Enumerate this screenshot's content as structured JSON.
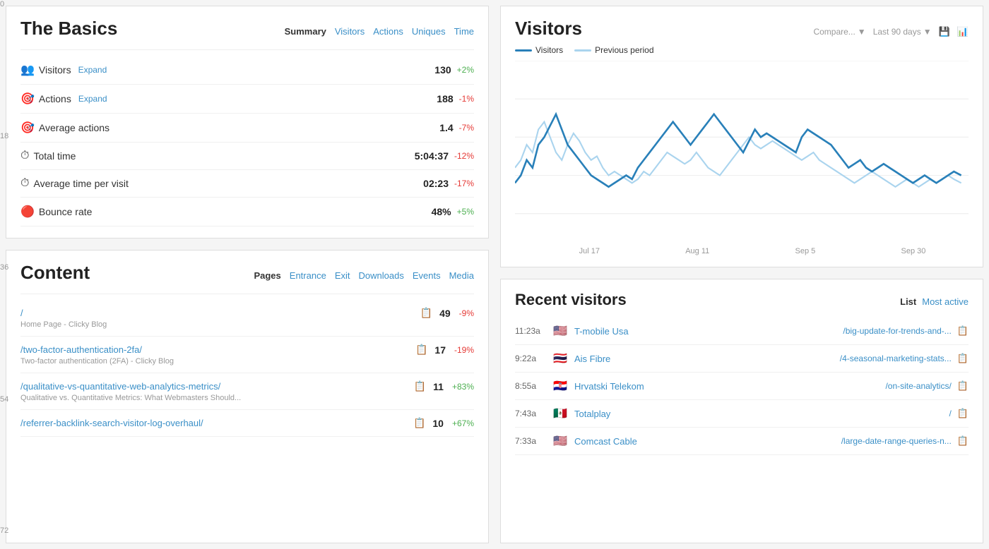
{
  "basics": {
    "title": "The Basics",
    "nav": {
      "summary": "Summary",
      "visitors": "Visitors",
      "actions": "Actions",
      "uniques": "Uniques",
      "time": "Time"
    },
    "stats": [
      {
        "icon": "👥",
        "label": "Visitors",
        "expand": true,
        "value": "130",
        "change": "+2%",
        "pos": true
      },
      {
        "icon": "🎯",
        "label": "Actions",
        "expand": true,
        "value": "188",
        "change": "-1%",
        "pos": false
      },
      {
        "icon": "🎯",
        "label": "Average actions",
        "expand": false,
        "value": "1.4",
        "change": "-7%",
        "pos": false
      },
      {
        "icon": "⏱",
        "label": "Total time",
        "expand": false,
        "value": "5:04:37",
        "change": "-12%",
        "pos": false
      },
      {
        "icon": "⏱",
        "label": "Average time per visit",
        "expand": false,
        "value": "02:23",
        "change": "-17%",
        "pos": false
      },
      {
        "icon": "🔴",
        "label": "Bounce rate",
        "expand": false,
        "value": "48%",
        "change": "+5%",
        "pos": true
      }
    ]
  },
  "visitors_chart": {
    "title": "Visitors",
    "compare_label": "Compare...",
    "period_label": "Last 90 days",
    "legend": {
      "visitors": "Visitors",
      "previous": "Previous period"
    },
    "y_labels": [
      "0",
      "18",
      "36",
      "54",
      "72"
    ],
    "x_labels": [
      "Jul 17",
      "Aug 11",
      "Sep 5",
      "Sep 30"
    ]
  },
  "content": {
    "title": "Content",
    "nav": {
      "pages": "Pages",
      "entrance": "Entrance",
      "exit": "Exit",
      "downloads": "Downloads",
      "events": "Events",
      "media": "Media"
    },
    "items": [
      {
        "url": "/",
        "subtitle": "Home Page - Clicky Blog",
        "value": "49",
        "change": "-9%",
        "pos": false
      },
      {
        "url": "/two-factor-authentication-2fa/",
        "subtitle": "Two-factor authentication (2FA) - Clicky Blog",
        "value": "17",
        "change": "-19%",
        "pos": false
      },
      {
        "url": "/qualitative-vs-quantitative-web-analytics-metrics/",
        "subtitle": "Qualitative vs. Quantitative Metrics: What Webmasters Should...",
        "value": "11",
        "change": "+83%",
        "pos": true
      },
      {
        "url": "/referrer-backlink-search-visitor-log-overhaul/",
        "subtitle": "",
        "value": "10",
        "change": "+67%",
        "pos": true
      }
    ]
  },
  "recent_visitors": {
    "title": "Recent visitors",
    "tabs": {
      "list": "List",
      "most_active": "Most active"
    },
    "items": [
      {
        "time": "11:23a",
        "flag": "🇺🇸",
        "name": "T-mobile Usa",
        "url": "/big-update-for-trends-and-..."
      },
      {
        "time": "9:22a",
        "flag": "🇹🇭",
        "name": "Ais Fibre",
        "url": "/4-seasonal-marketing-stats..."
      },
      {
        "time": "8:55a",
        "flag": "🇭🇷",
        "name": "Hrvatski Telekom",
        "url": "/on-site-analytics/"
      },
      {
        "time": "7:43a",
        "flag": "🇲🇽",
        "name": "Totalplay",
        "url": "/"
      },
      {
        "time": "7:33a",
        "flag": "🇺🇸",
        "name": "Comcast Cable",
        "url": "/large-date-range-queries-n..."
      }
    ]
  }
}
